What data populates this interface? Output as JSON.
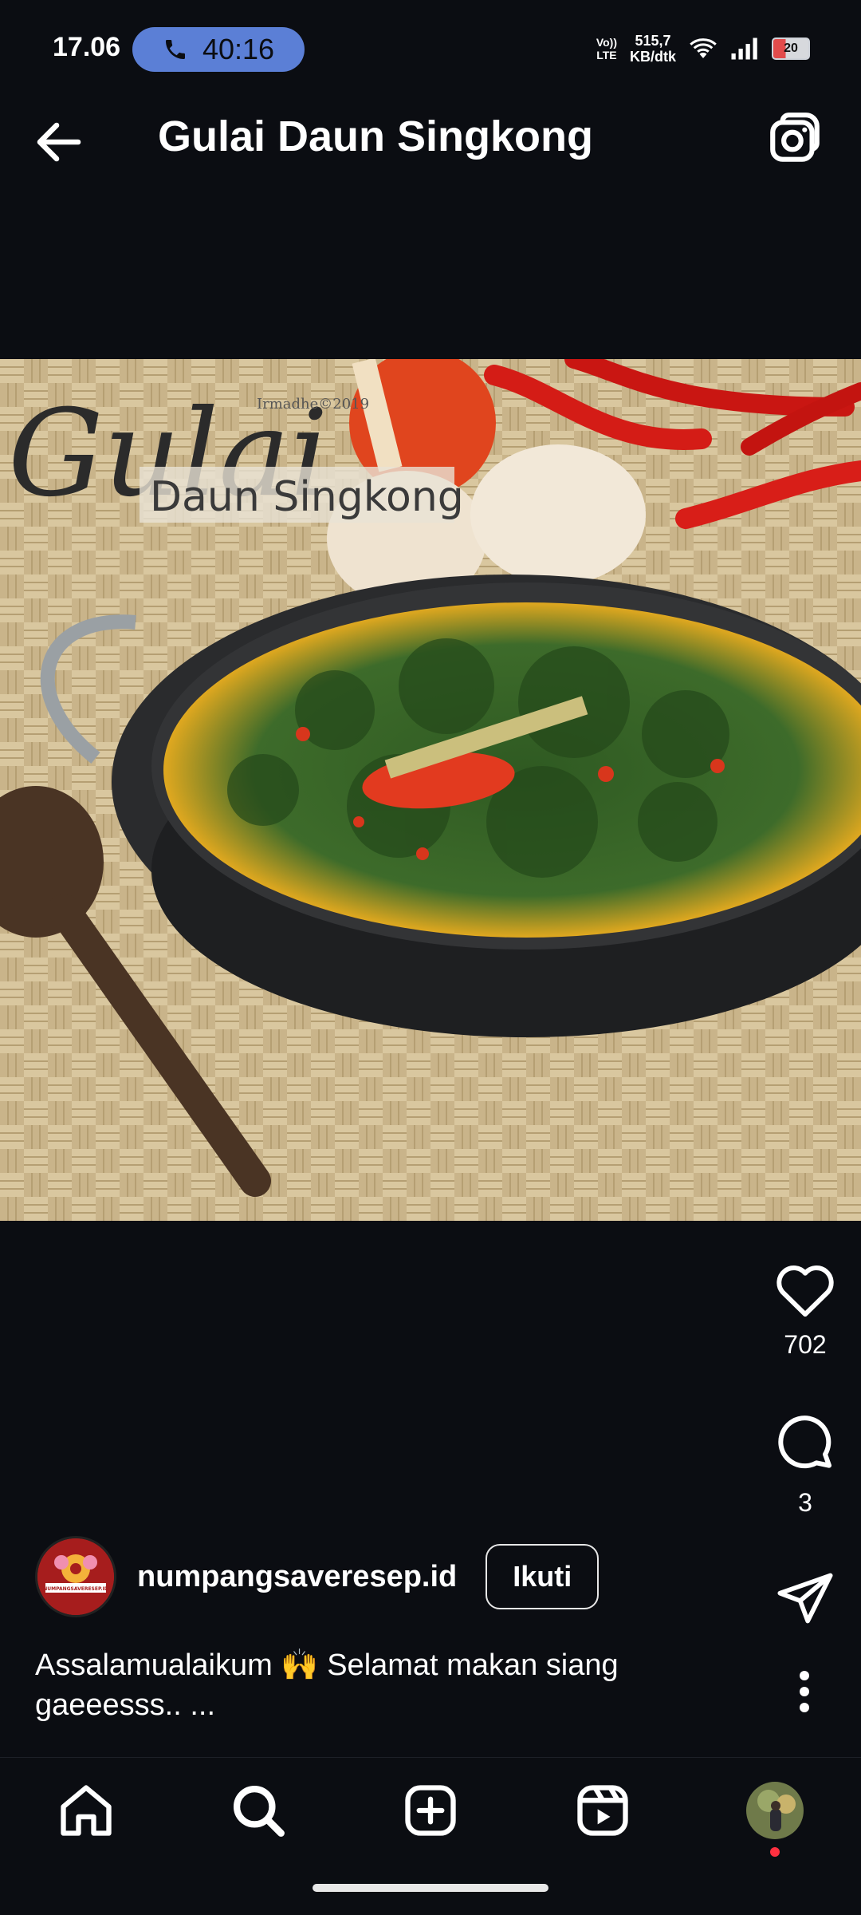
{
  "status_bar": {
    "time": "17.06",
    "call_timer": "40:16",
    "volte_line1": "Vo))",
    "volte_line2": "LTE",
    "speed_value": "515,7",
    "speed_unit": "KB/dtk",
    "battery": "20"
  },
  "header": {
    "title": "Gulai Daun Singkong"
  },
  "post": {
    "image_overlay_script": "Gulai",
    "image_overlay_label": "Daun Singkong",
    "image_watermark": "Irmadhe©2019",
    "likes": "702",
    "comments": "3"
  },
  "author": {
    "username": "numpangsaveresep.id",
    "follow_label": "Ikuti",
    "avatar_text": "NUMPANGSAVERESEP.ID"
  },
  "caption": {
    "text": "Assalamualaikum 🙌 Selamat makan siang gaeeesss.. ..."
  },
  "colors": {
    "background": "#0b0d12",
    "call_pill": "#5b7fd6",
    "notification_dot": "#ff3040"
  },
  "icons": {
    "back": "arrow-left-icon",
    "camera": "camera-icon",
    "like": "heart-icon",
    "comment": "comment-icon",
    "share": "send-icon",
    "more": "more-vertical-icon",
    "nav": [
      "home-icon",
      "search-icon",
      "add-icon",
      "reels-icon",
      "profile-icon"
    ]
  }
}
